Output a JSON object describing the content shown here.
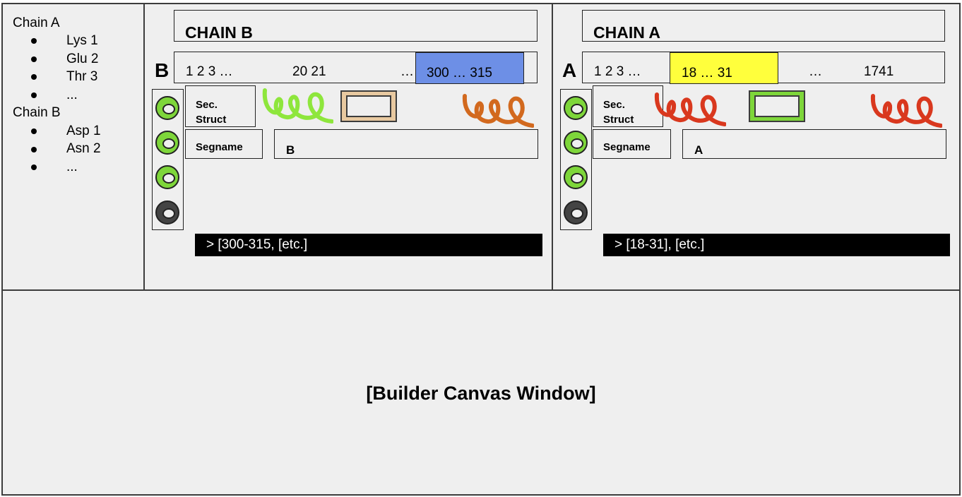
{
  "tree": {
    "chains": [
      {
        "label": "Chain A",
        "items": [
          "Lys 1",
          "Glu 2",
          "Thr 3",
          "..."
        ]
      },
      {
        "label": "Chain B",
        "items": [
          "Asp 1",
          "Asn 2",
          "..."
        ]
      }
    ]
  },
  "panel_b": {
    "title": "CHAIN B",
    "chain_letter": "B",
    "residues_start": "1 2 3 …",
    "residues_mid": "20 21",
    "residues_ellipsis": "…",
    "selection_label": "300 … 315",
    "selection_color": "#6d8fe6",
    "sec_struct_label": "Sec. Struct",
    "segname_label": "Segname",
    "segname_value": "B",
    "command": "> [300-315, [etc.]",
    "toggles": [
      "on",
      "on",
      "on",
      "off"
    ]
  },
  "panel_a": {
    "title": "CHAIN A",
    "chain_letter": "A",
    "residues_start": "1 2 3 …",
    "selection_label": "18 … 31",
    "residues_ellipsis": "…",
    "residues_end": "1741",
    "selection_color": "#ffff3c",
    "sec_struct_label": "Sec. Struct",
    "segname_label": "Segname",
    "segname_value": "A",
    "command": "> [18-31], [etc.]",
    "toggles": [
      "on",
      "on",
      "on",
      "off"
    ]
  },
  "canvas": {
    "label": "[Builder Canvas Window]"
  },
  "colors": {
    "toggle_on": "#7ed63a",
    "toggle_off": "#444444",
    "helix_green": "#8ee63c",
    "helix_orange": "#d2691e",
    "helix_red": "#d9381e",
    "strand_tan": "#e8c9a0",
    "strand_green": "#7ed63a"
  }
}
